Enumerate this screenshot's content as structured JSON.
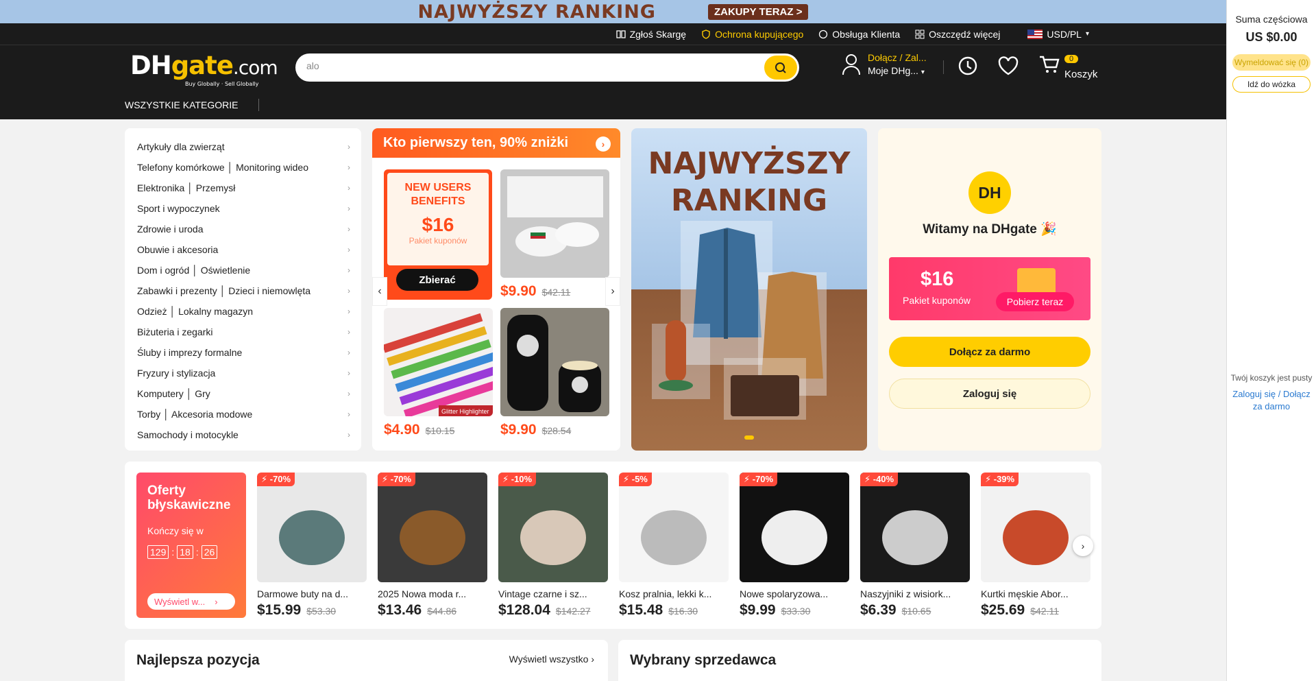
{
  "promo": {
    "title": "NAJWYŻSZY RANKING",
    "button": "ZAKUPY TERAZ >"
  },
  "topbar": {
    "complaint": "Zgłoś Skargę",
    "protection": "Ochrona kupującego",
    "service": "Obsługa Klienta",
    "save": "Oszczędź więcej",
    "currency": "USD/PL"
  },
  "logo": {
    "dh": "DH",
    "gate": "gate",
    ".com": ".com",
    "tagline": "Buy Globally · Sell Globally"
  },
  "search": {
    "value": "alo"
  },
  "account": {
    "line1": "Dołącz / Zal...",
    "line2": "Moje DHg..."
  },
  "cart": {
    "count": "0",
    "label": "Koszyk"
  },
  "categories_label": "WSZYSTKIE KATEGORIE",
  "categories": [
    "Artykuły dla zwierząt",
    "Telefony komórkowe │ Monitoring wideo",
    "Elektronika │ Przemysł",
    "Sport i wypoczynek",
    "Zdrowie i uroda",
    "Obuwie i akcesoria",
    "Dom i ogród │ Oświetlenie",
    "Zabawki i prezenty │ Dzieci i niemowlęta",
    "Odzież │ Lokalny magazyn",
    "Biżuteria i zegarki",
    "Śluby i imprezy formalne",
    "Fryzury i stylizacja",
    "Komputery │ Gry",
    "Torby │ Akcesoria modowe",
    "Samochody i motocykle"
  ],
  "deal": {
    "title": "Kto pierwszy ten, 90% zniżki",
    "coupon_title": "NEW USERS BENEFITS",
    "coupon_value": "$16",
    "coupon_sub": "Pakiet kuponów",
    "coupon_btn": "Zbierać",
    "p1": {
      "price": "$9.90",
      "old": "$42.11"
    },
    "p2": {
      "price": "$4.90",
      "old": "$10.15",
      "tag": "Glitter Highlighter"
    },
    "p3": {
      "price": "$9.90",
      "old": "$28.54"
    }
  },
  "banner": {
    "title": "NAJWYŻSZY RANKING"
  },
  "welcome": {
    "logo": "DH",
    "title": "Witamy na DHgate 🎉",
    "coupon_value": "$16",
    "coupon_sub": "Pakiet kuponów",
    "coupon_btn": "Pobierz teraz",
    "join": "Dołącz za darmo",
    "login": "Zaloguj się"
  },
  "flash": {
    "title": "Oferty błyskawiczne",
    "ends": "Kończy się w",
    "h": "129",
    "m": "18",
    "s": "26",
    "more": "Wyświetl w...",
    "items": [
      {
        "disc": "⚡ -70%",
        "name": "Darmowe buty na d...",
        "price": "$15.99",
        "old": "$53.30"
      },
      {
        "disc": "⚡ -70%",
        "name": "2025 Nowa moda r...",
        "price": "$13.46",
        "old": "$44.86"
      },
      {
        "disc": "⚡ -10%",
        "name": "Vintage czarne i sz...",
        "price": "$128.04",
        "old": "$142.27"
      },
      {
        "disc": "⚡ -5%",
        "name": "Kosz pralnia, lekki k...",
        "price": "$15.48",
        "old": "$16.30"
      },
      {
        "disc": "⚡ -70%",
        "name": "Nowe spolaryzowa...",
        "price": "$9.99",
        "old": "$33.30"
      },
      {
        "disc": "⚡ -40%",
        "name": "Naszyjniki z wisiork...",
        "price": "$6.39",
        "old": "$10.65"
      },
      {
        "disc": "⚡ -39%",
        "name": "Kurtki męskie Abor...",
        "price": "$25.69",
        "old": "$42.11"
      }
    ]
  },
  "best": {
    "title": "Najlepsza pozycja",
    "more": "Wyświetl wszystko"
  },
  "seller": {
    "title": "Wybrany sprzedawca"
  },
  "sidebar": {
    "subtotal_label": "Suma częściowa",
    "subtotal": "US $0.00",
    "checkout": "Wymeldować się (0)",
    "go_cart": "Idź do wózka",
    "empty": "Twój koszyk jest pusty",
    "login": "Zaloguj się",
    "join": "Dołącz za darmo"
  }
}
